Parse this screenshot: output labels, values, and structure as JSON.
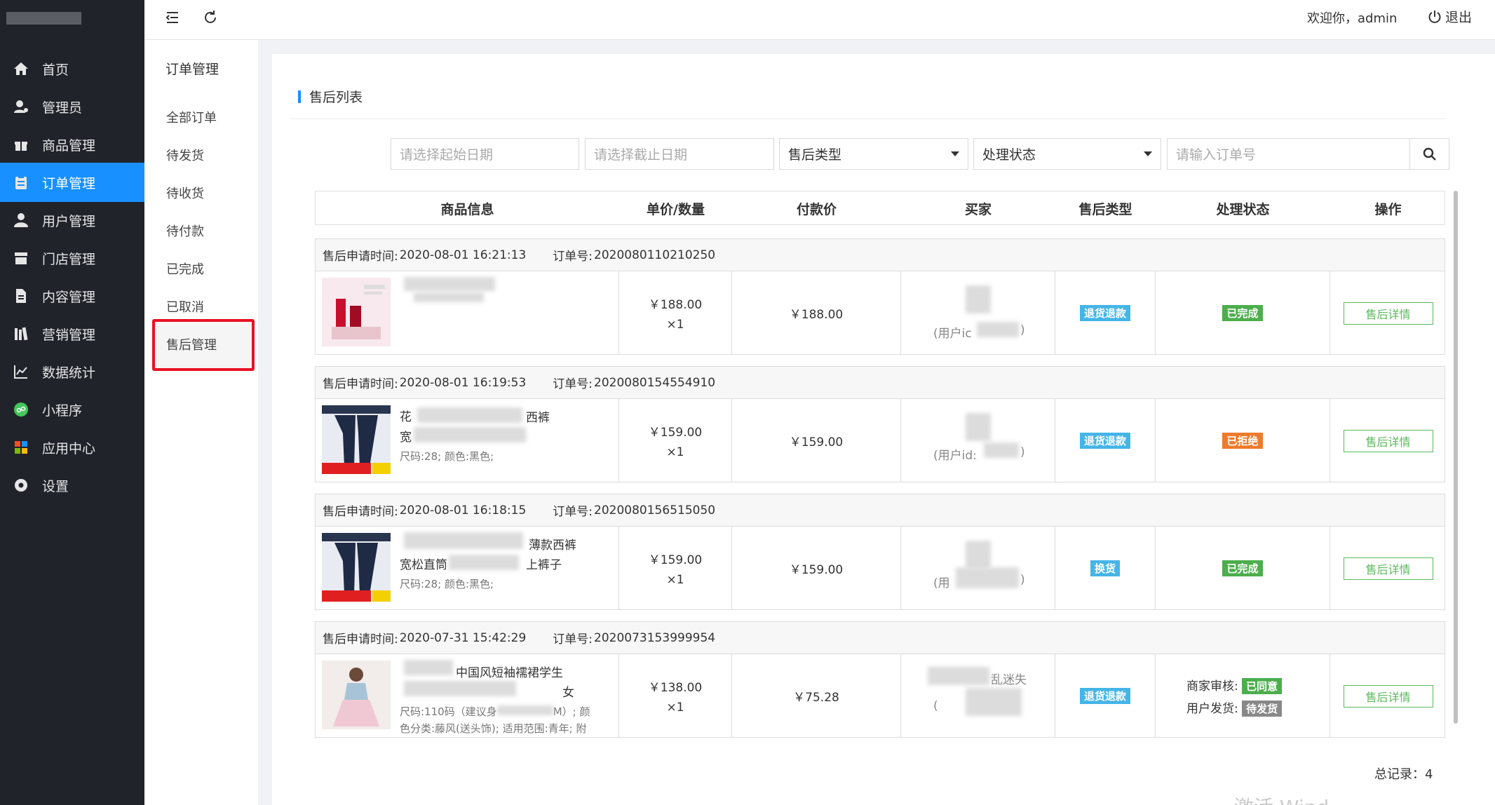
{
  "sidebar": {
    "items": [
      {
        "label": "首页",
        "icon": "home-icon"
      },
      {
        "label": "管理员",
        "icon": "admin-icon"
      },
      {
        "label": "商品管理",
        "icon": "gift-icon"
      },
      {
        "label": "订单管理",
        "icon": "clipboard-icon"
      },
      {
        "label": "用户管理",
        "icon": "user-icon"
      },
      {
        "label": "门店管理",
        "icon": "store-icon"
      },
      {
        "label": "内容管理",
        "icon": "document-icon"
      },
      {
        "label": "营销管理",
        "icon": "books-icon"
      },
      {
        "label": "数据统计",
        "icon": "line-chart-icon"
      },
      {
        "label": "小程序",
        "icon": "mini-program-icon"
      },
      {
        "label": "应用中心",
        "icon": "apps-icon"
      },
      {
        "label": "设置",
        "icon": "gear-icon"
      }
    ],
    "active_index": 3
  },
  "subnav": {
    "title": "订单管理",
    "items": [
      "全部订单",
      "待发货",
      "待收货",
      "待付款",
      "已完成",
      "已取消",
      "售后管理"
    ]
  },
  "topbar": {
    "welcome": "欢迎你，admin",
    "logout": "退出"
  },
  "page": {
    "title": "售后列表"
  },
  "filters": {
    "start_date_placeholder": "请选择起始日期",
    "end_date_placeholder": "请选择截止日期",
    "type_select": "售后类型",
    "status_select": "处理状态",
    "order_placeholder": "请输入订单号"
  },
  "table": {
    "headers": [
      "商品信息",
      "单价/数量",
      "付款价",
      "买家",
      "售后类型",
      "处理状态",
      "操作"
    ],
    "labels": {
      "apply_time": "售后申请时间:",
      "order_no": "订单号:",
      "detail_button": "售后详情"
    },
    "orders": [
      {
        "apply_time": "2020-08-01 16:21:13",
        "order_no": "2020080110210250",
        "product_name": "",
        "spec": "",
        "unit_price": "￥188.00",
        "qty": "×1",
        "pay_price": "￥188.00",
        "buyer": "(用户ic",
        "buyer_suffix": ")",
        "type": "退货退款",
        "status": "已完成"
      },
      {
        "apply_time": "2020-08-01 16:19:53",
        "order_no": "2020080154554910",
        "product_name_a": "花",
        "product_name_b": "西裤",
        "product_name_c": "宽",
        "spec": "尺码:28; 颜色:黑色;",
        "unit_price": "￥159.00",
        "qty": "×1",
        "pay_price": "￥159.00",
        "buyer": "(用户id:",
        "buyer_suffix": ")",
        "type": "退货退款",
        "status": "已拒绝"
      },
      {
        "apply_time": "2020-08-01 16:18:15",
        "order_no": "2020080156515050",
        "product_name_a": "薄款西裤",
        "product_name_b": "宽松直筒",
        "product_name_c": "上裤子",
        "spec": "尺码:28; 颜色:黑色;",
        "unit_price": "￥159.00",
        "qty": "×1",
        "pay_price": "￥159.00",
        "buyer": "(用",
        "buyer_suffix": ")",
        "type": "换货",
        "status": "已完成"
      },
      {
        "apply_time": "2020-07-31 15:42:29",
        "order_no": "2020073153999954",
        "product_name_a": "中国风短袖襦裙学生",
        "product_name_b": "女",
        "spec_a": "尺码:110码（建议身",
        "spec_b": "M）; 颜",
        "spec_c": "色分类:藤风(送头饰); 适用范围:青年; 附",
        "unit_price": "￥138.00",
        "qty": "×1",
        "pay_price": "￥75.28",
        "buyer": "(",
        "buyer_extra": "乱迷失",
        "type": "退货退款",
        "merchant_review_label": "商家审核:",
        "merchant_review": "已同意",
        "user_ship_label": "用户发货:",
        "user_ship": "待发货"
      }
    ]
  },
  "footer": {
    "total": "总记录：4",
    "watermark": "激活 Wind"
  }
}
